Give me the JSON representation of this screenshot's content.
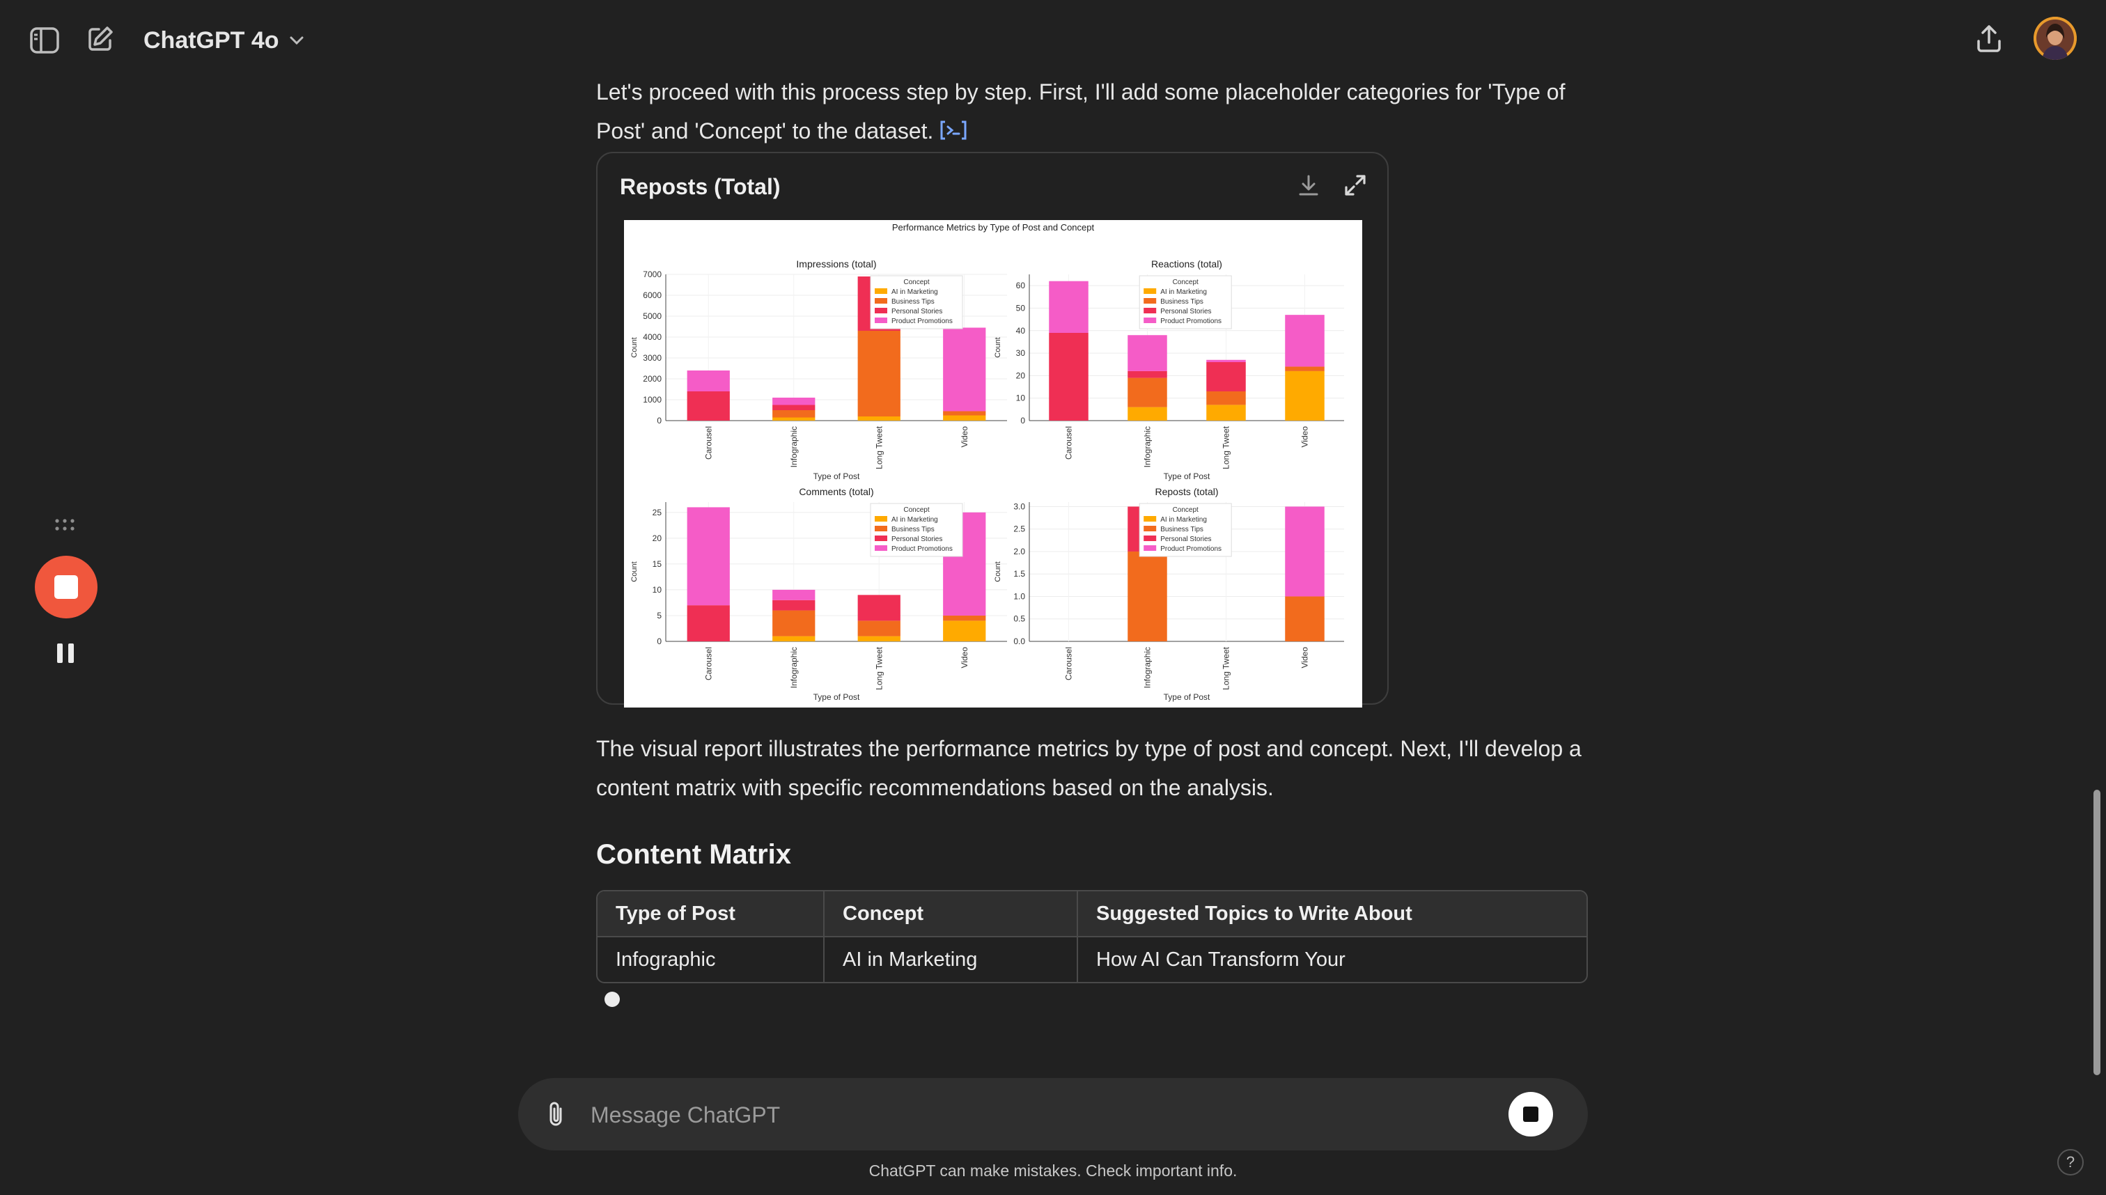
{
  "header": {
    "model_name": "ChatGPT 4o"
  },
  "messages": {
    "intro_text": "Let's proceed with this process step by step. First, I'll add some placeholder categories for 'Type of Post' and 'Concept' to the dataset.",
    "after_chart_text": "The visual report illustrates the performance metrics by type of post and concept. Next, I'll develop a content matrix with specific recommendations based on the analysis.",
    "section_heading": "Content Matrix"
  },
  "chart_card": {
    "title": "Reposts (Total)"
  },
  "chart_data": {
    "type": "bar",
    "title": "Performance Metrics by Type of Post and Concept",
    "stacked": true,
    "legend_title": "Concept",
    "categories": [
      "Carousel",
      "Infographic",
      "Long Tweet",
      "Video"
    ],
    "series_names": [
      "AI in Marketing",
      "Business Tips",
      "Personal Stories",
      "Product Promotions"
    ],
    "colors": [
      "#ffaa00",
      "#f26b1d",
      "#ef2f54",
      "#f55cc7"
    ],
    "xlabel": "Type of Post",
    "ylabel": "Count",
    "subplots": [
      {
        "title": "Impressions (total)",
        "ylim": [
          0,
          7000
        ],
        "yticks": [
          0,
          1000,
          2000,
          3000,
          4000,
          5000,
          6000,
          7000
        ],
        "series": [
          {
            "name": "AI in Marketing",
            "values": [
              0,
              150,
              200,
              250
            ]
          },
          {
            "name": "Business Tips",
            "values": [
              0,
              350,
              4100,
              200
            ]
          },
          {
            "name": "Personal Stories",
            "values": [
              1400,
              250,
              2600,
              0
            ]
          },
          {
            "name": "Product Promotions",
            "values": [
              1000,
              350,
              0,
              4000
            ]
          }
        ]
      },
      {
        "title": "Reactions (total)",
        "ylim": [
          0,
          65
        ],
        "yticks": [
          0,
          10,
          20,
          30,
          40,
          50,
          60
        ],
        "series": [
          {
            "name": "AI in Marketing",
            "values": [
              0,
              6,
              7,
              22
            ]
          },
          {
            "name": "Business Tips",
            "values": [
              0,
              13,
              6,
              2
            ]
          },
          {
            "name": "Personal Stories",
            "values": [
              39,
              3,
              13,
              0
            ]
          },
          {
            "name": "Product Promotions",
            "values": [
              23,
              16,
              1,
              23
            ]
          }
        ]
      },
      {
        "title": "Comments (total)",
        "ylim": [
          0,
          27
        ],
        "yticks": [
          0,
          5,
          10,
          15,
          20,
          25
        ],
        "series": [
          {
            "name": "AI in Marketing",
            "values": [
              0,
              1,
              1,
              4
            ]
          },
          {
            "name": "Business Tips",
            "values": [
              0,
              5,
              3,
              1
            ]
          },
          {
            "name": "Personal Stories",
            "values": [
              7,
              2,
              5,
              0
            ]
          },
          {
            "name": "Product Promotions",
            "values": [
              19,
              2,
              0,
              20
            ]
          }
        ]
      },
      {
        "title": "Reposts (total)",
        "ylim": [
          0,
          3.1
        ],
        "yticks": [
          0,
          0.5,
          1.0,
          1.5,
          2.0,
          2.5,
          3.0
        ],
        "series": [
          {
            "name": "AI in Marketing",
            "values": [
              0,
              0,
              0,
              0
            ]
          },
          {
            "name": "Business Tips",
            "values": [
              0,
              2,
              0,
              1
            ]
          },
          {
            "name": "Personal Stories",
            "values": [
              0,
              1,
              0,
              0
            ]
          },
          {
            "name": "Product Promotions",
            "values": [
              0,
              0,
              0,
              2
            ]
          }
        ]
      }
    ]
  },
  "table": {
    "headers": [
      "Type of Post",
      "Concept",
      "Suggested Topics to Write About"
    ],
    "rows": [
      [
        "Infographic",
        "AI in Marketing",
        "How AI Can Transform Your"
      ]
    ]
  },
  "composer": {
    "placeholder": "Message ChatGPT"
  },
  "footer": {
    "disclaimer": "ChatGPT can make mistakes. Check important info.",
    "help": "?"
  }
}
